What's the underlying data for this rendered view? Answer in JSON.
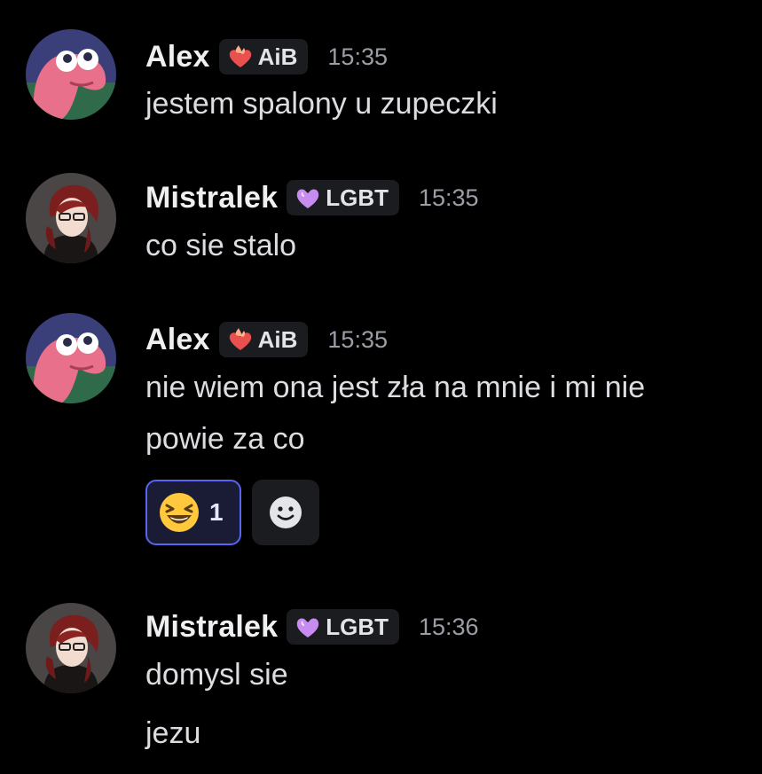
{
  "messages": [
    {
      "author": "Alex",
      "tag": "AiB",
      "time": "15:35",
      "lines": [
        "jestem spalony u zupeczki"
      ]
    },
    {
      "author": "Mistralek",
      "tag": "LGBT",
      "time": "15:35",
      "lines": [
        "co sie stalo"
      ]
    },
    {
      "author": "Alex",
      "tag": "AiB",
      "time": "15:35",
      "lines": [
        "nie wiem ona jest zła na mnie i mi nie",
        "powie za co"
      ],
      "reactions": [
        {
          "emoji": "laughing-face",
          "count": "1"
        }
      ]
    },
    {
      "author": "Mistralek",
      "tag": "LGBT",
      "time": "15:36",
      "lines": [
        "domysl sie",
        "jezu"
      ]
    }
  ],
  "icons": {
    "aib_tag": "fire-heart-icon",
    "lgbt_tag": "purple-heart-icon",
    "add_reaction": "smiley-add-reaction-icon"
  },
  "colors": {
    "background": "#000000",
    "reaction_border": "#5865f2",
    "tag_background": "#1b1c20",
    "timestamp": "#9b9ea6"
  }
}
